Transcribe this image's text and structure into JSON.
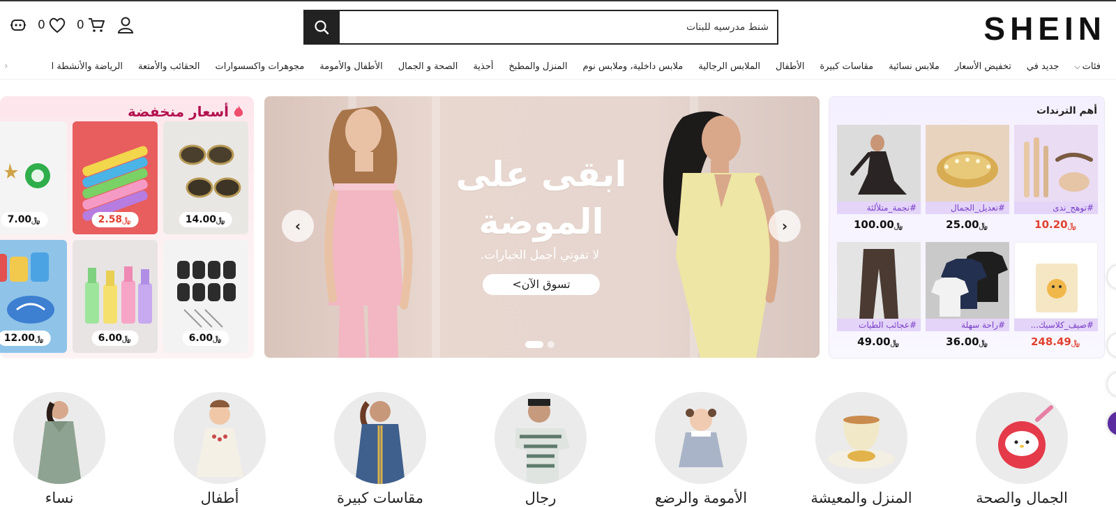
{
  "header": {
    "logo": "SHEIN",
    "search_placeholder": "شنط مدرسيه للبنات",
    "cart_count": "0",
    "wishlist_count": "0"
  },
  "nav": {
    "items": [
      "فئات",
      "جديد في",
      "تخفيض الأسعار",
      "ملابس نسائية",
      "مقاسات كبيرة",
      "الأطفال",
      "الملابس الرجالية",
      "ملابس داخلية، وملابس نوم",
      "المنزل والمطبخ",
      "أحذية",
      "الصحة و الجمال",
      "الأطفال والأمومة",
      "مجوهرات واكسسوارات",
      "الحقائب والأمتعة",
      "الرياضة والأنشطة ا"
    ]
  },
  "deals": {
    "title": "أسعار منخفضة",
    "currency": "﷼",
    "items": [
      {
        "price": "14.00",
        "red": false,
        "icon": "sunglasses"
      },
      {
        "price": "2.58",
        "red": true,
        "icon": "clay-sticks"
      },
      {
        "price": "7.00",
        "red": false,
        "icon": "brooch"
      },
      {
        "price": "6.00",
        "red": false,
        "icon": "hair-rollers"
      },
      {
        "price": "6.00",
        "red": false,
        "icon": "lip-oils"
      },
      {
        "price": "12.00",
        "red": false,
        "icon": "kids-clay"
      }
    ]
  },
  "banner": {
    "headline_line1": "ابقى على",
    "headline_line2": "الموضة",
    "subtitle": "لا تفوتي أجمل الخيارات.",
    "cta": "تسوق الآن>"
  },
  "trends": {
    "title": "أهم الترندات",
    "currency": "﷼",
    "items": [
      {
        "tag": "#توهج_ندى",
        "price": "10.20",
        "red": true,
        "icon": "brows"
      },
      {
        "tag": "#تعديل_الجمال",
        "price": "25.00",
        "red": false,
        "icon": "bracelet"
      },
      {
        "tag": "#نجمة_متلألئة",
        "price": "100.00",
        "red": false,
        "icon": "lace-dress"
      },
      {
        "tag": "#صيف_كلاسيك...",
        "price": "248.49",
        "red": true,
        "icon": "toy-box"
      },
      {
        "tag": "#راحة سهلة",
        "price": "36.00",
        "red": false,
        "icon": "tshirts"
      },
      {
        "tag": "#عجائب الطيات",
        "price": "49.00",
        "red": false,
        "icon": "trousers"
      }
    ]
  },
  "categories": [
    {
      "label": "الجمال والصحة",
      "icon": "beauty"
    },
    {
      "label": "المنزل والمعيشة",
      "icon": "teacup"
    },
    {
      "label": "الأمومة والرضع",
      "icon": "baby"
    },
    {
      "label": "رجال",
      "icon": "men"
    },
    {
      "label": "مقاسات كبيرة",
      "icon": "plus-size"
    },
    {
      "label": "أطفال",
      "icon": "kids"
    },
    {
      "label": "نساء",
      "icon": "women"
    }
  ],
  "colors": {
    "accent": "#222222",
    "sale_red": "#e2402f",
    "deals_title": "#b3114f",
    "trend_tag": "#7a3fc7"
  }
}
